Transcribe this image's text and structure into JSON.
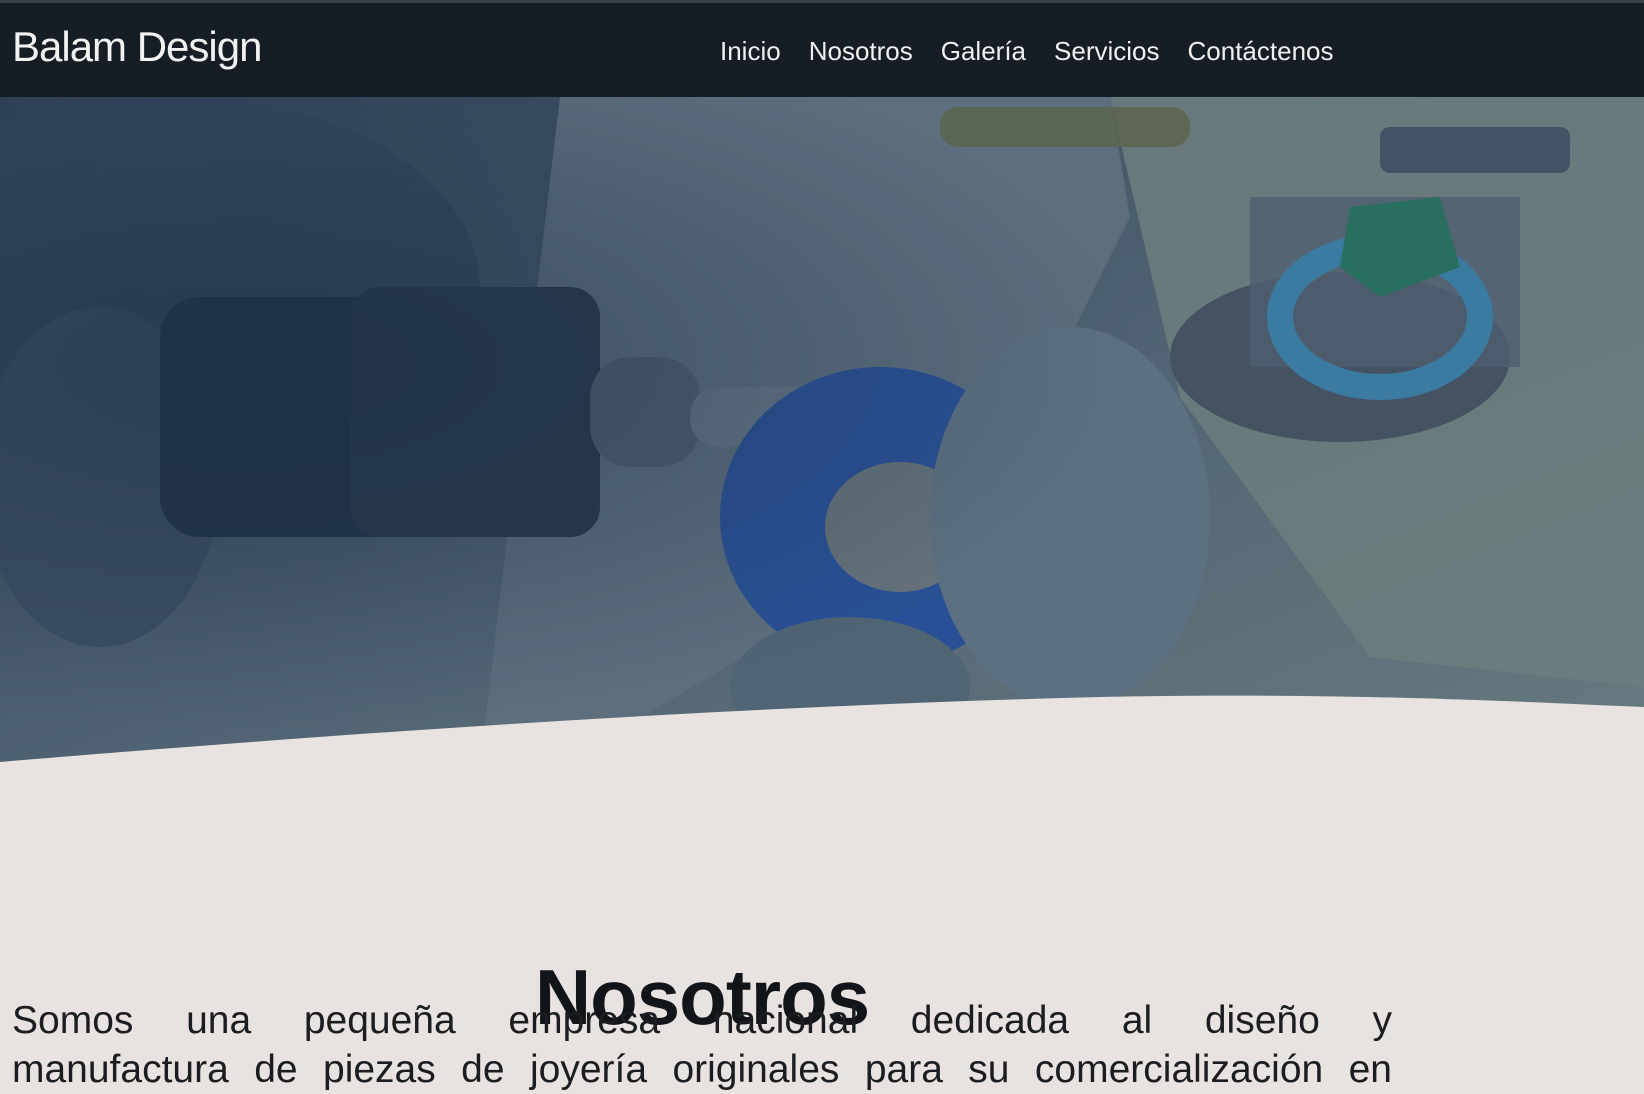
{
  "brand": {
    "name": "Balam Design"
  },
  "nav": {
    "items": [
      {
        "label": "Inicio"
      },
      {
        "label": "Nosotros"
      },
      {
        "label": "Galería"
      },
      {
        "label": "Servicios"
      },
      {
        "label": "Contáctenos"
      }
    ]
  },
  "hero": {
    "image_description_icon": "jewelry-workbench-image",
    "overlay_color": "#1f3b5b"
  },
  "about": {
    "title": "Nosotros",
    "text_line1": "Somos una pequeña empresa nacional dedicada al diseño y",
    "text_line2": "manufactura de piezas de joyería originales para su comercialización en"
  },
  "colors": {
    "nav_bg": "#171d25",
    "page_bg": "#e8e3e0",
    "text_dark": "#111418"
  }
}
